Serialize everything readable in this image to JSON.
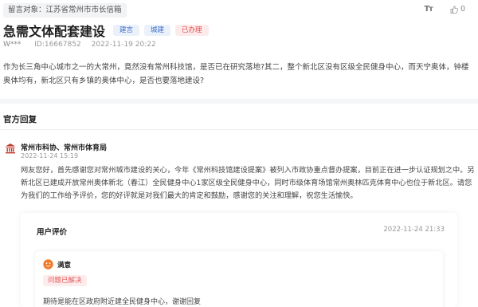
{
  "header": {
    "recipient": "留言对象：江苏省常州市市长信箱",
    "font_size_icon": "Tт",
    "like_count": "0"
  },
  "post": {
    "title": "急需文体配套建设",
    "tags": [
      {
        "label": "建言",
        "color": "#3d6ec9"
      },
      {
        "label": "城建",
        "color": "#3d6ec9"
      },
      {
        "label": "已办理",
        "color": "#e24b4b"
      }
    ],
    "user": "W***",
    "id": "ID:16667852",
    "date": "2022-11-19 20:22",
    "body": "作为长三角中心城市之一的大常州，竟然没有常州科技馆，是否已在研究落地?其二，整个新北区没有区级全民健身中心，而天宁奥体，钟楼奥体均有，新北区只有乡镇的奥体中心，是否也要落地建设?"
  },
  "official_reply": {
    "heading": "官方回复",
    "org": "常州市科协、常州市体育局",
    "time": "2022-11-24 15:19",
    "body": "网友您好，首先感谢您对常州城市建设的关心，今年《常州科技馆建设提案》被列入市政协重点督办提案，目前正在进一步认证规划之中。另新北区已建成开放常州奥体新北（春江）全民健身中心1家区级全民健身中心，同时市级体育场馆常州奥林匹克体育中心也位于新北区。请您为我们的工作给予评价，您的好评就是对我们最大的肯定和鼓励，感谢您的关注和理解，祝您生活愉快。"
  },
  "rating": {
    "heading": "用户评价",
    "time": "2022-11-24 21:33",
    "satisfaction": "满意",
    "status": "问题已解决",
    "comment": "期待是能在区政府附近建全民健身中心，谢谢回复"
  },
  "colors": {
    "accent_blue": "#3d6ec9",
    "accent_red": "#e24b4b",
    "org_icon": "#c0392b",
    "face_icon": "#f07b2b"
  }
}
